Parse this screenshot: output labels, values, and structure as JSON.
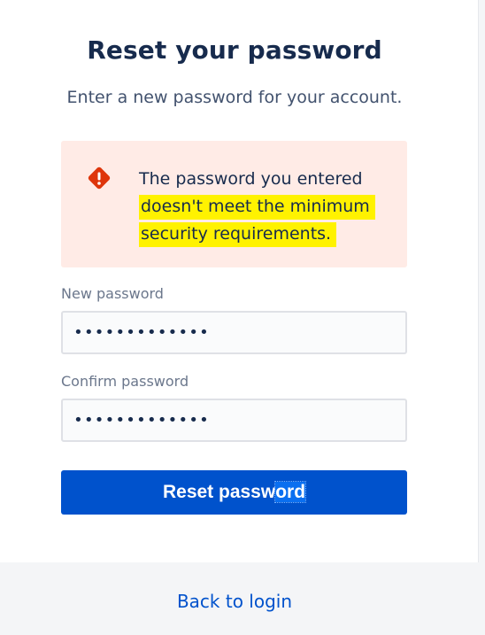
{
  "page": {
    "title": "Reset your password",
    "subtitle": "Enter a new password for your account."
  },
  "alert": {
    "icon": "error-icon",
    "color": "#de350b",
    "line1": "The password you entered",
    "line2": "doesn't meet the minimum",
    "line3": "security requirements."
  },
  "form": {
    "new_password_label": "New password",
    "new_password_value": "•••••••••••••",
    "confirm_password_label": "Confirm password",
    "confirm_password_value": "•••••••••••••",
    "submit_label_main": "Reset passw",
    "submit_label_selected": "ord"
  },
  "footer": {
    "back_link": "Back to login"
  },
  "colors": {
    "accent": "#0052cc",
    "alert_bg": "#ffebe6",
    "highlight": "#fff200"
  }
}
